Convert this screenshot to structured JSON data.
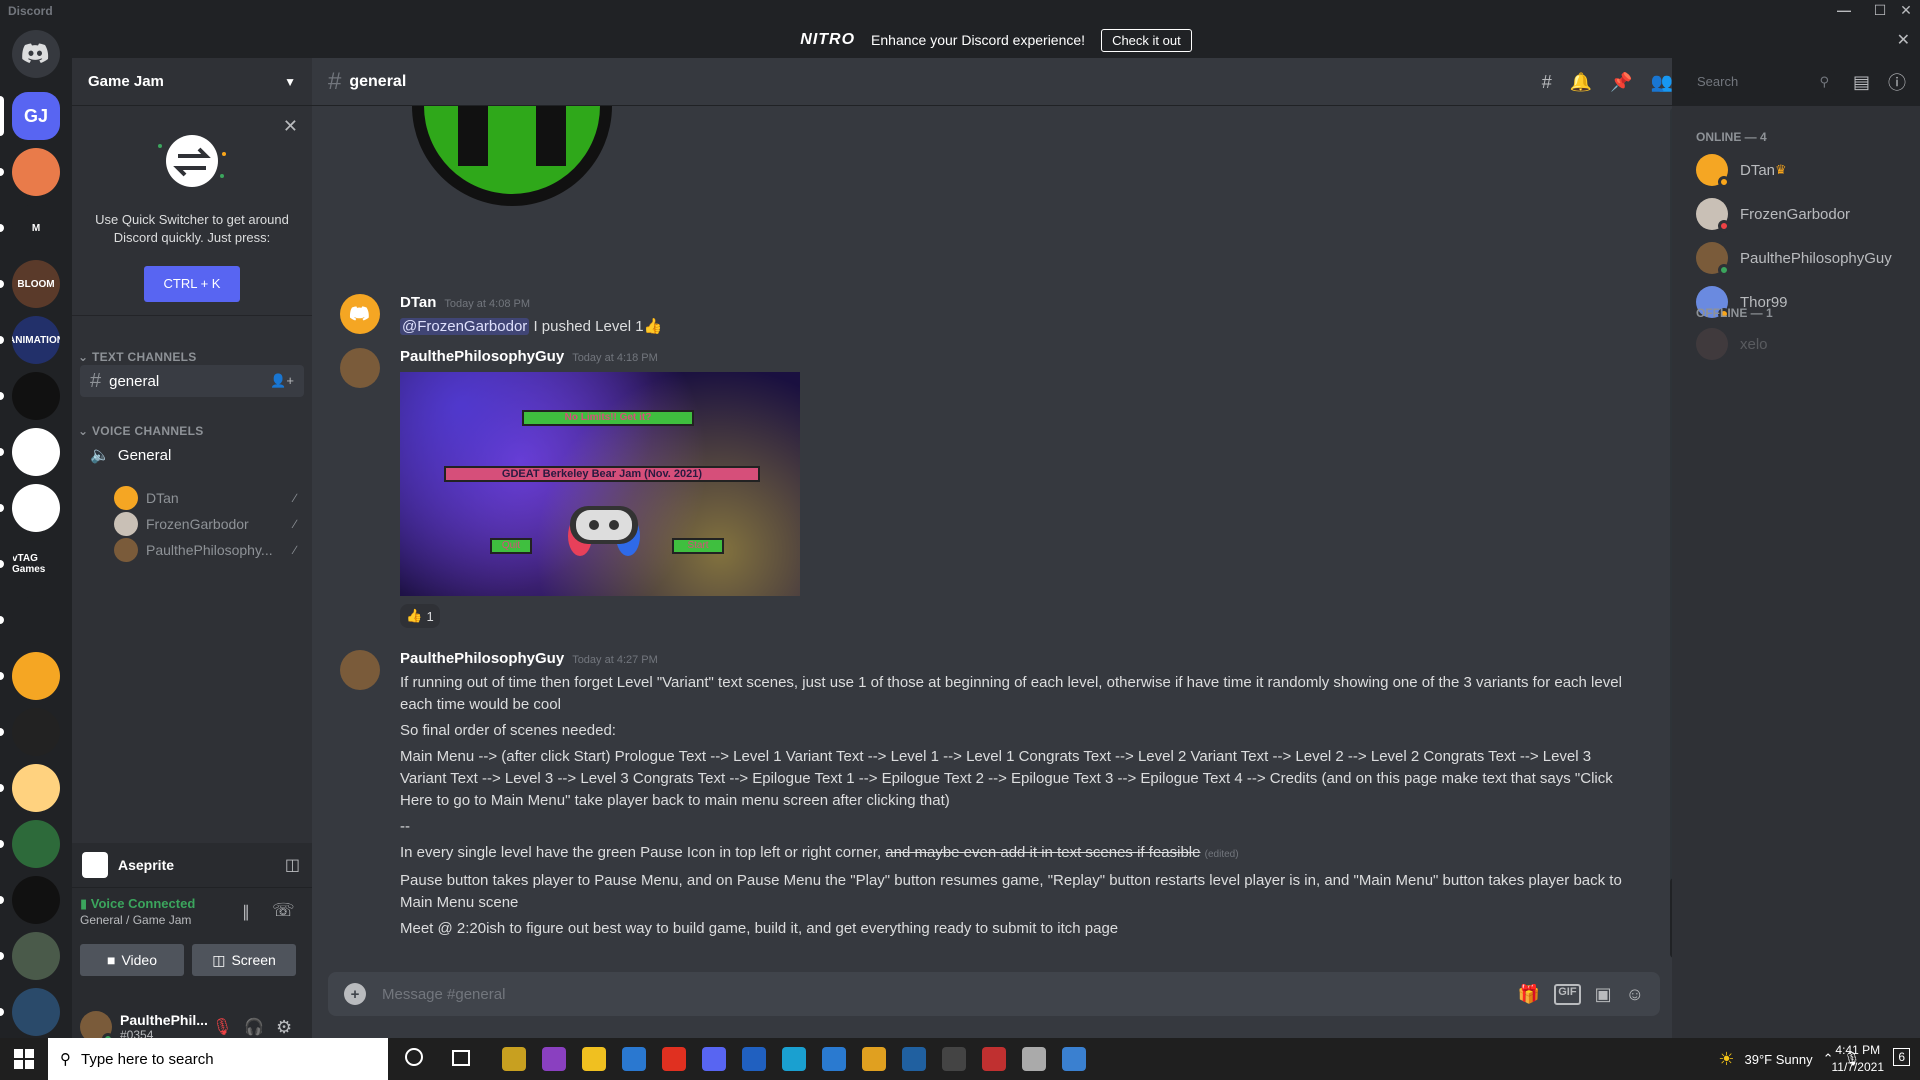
{
  "window": {
    "title": "Discord"
  },
  "banner": {
    "logo": "NITRO",
    "text": "Enhance your Discord experience!",
    "cta": "Check it out"
  },
  "rail": {
    "home_icon": "discord-logo-icon",
    "servers": [
      {
        "label": "GJ",
        "color": "#5865f2"
      },
      {
        "label": "",
        "color": "#e97b4a"
      },
      {
        "label": "M",
        "color": "#202225"
      },
      {
        "label": "BLOOM",
        "color": "#5a3a2a"
      },
      {
        "label": "ANIMATION",
        "color": "#22306a"
      },
      {
        "label": "",
        "color": "#111"
      },
      {
        "label": "",
        "color": "#fff"
      },
      {
        "label": "",
        "color": "#fff"
      },
      {
        "label": "vTAG Games",
        "color": "#202225"
      },
      {
        "label": "",
        "color": "#202225"
      },
      {
        "label": "",
        "color": "#f5a623"
      },
      {
        "label": "",
        "color": "#222"
      },
      {
        "label": "",
        "color": "#ffd27f"
      },
      {
        "label": "",
        "color": "#2d6a3a"
      },
      {
        "label": "",
        "color": "#111"
      },
      {
        "label": "",
        "color": "#4a5a4a"
      },
      {
        "label": "",
        "color": "#2a4a6a"
      }
    ]
  },
  "sidebar": {
    "guild_name": "Game Jam",
    "quick_switcher": {
      "text": "Use Quick Switcher to get around Discord quickly. Just press:",
      "button": "CTRL + K"
    },
    "text_category": "TEXT CHANNELS",
    "text_channels": [
      {
        "name": "general"
      }
    ],
    "voice_category": "VOICE CHANNELS",
    "voice_channels": [
      {
        "name": "General",
        "users": [
          {
            "name": "DTan",
            "color": "#f5a623"
          },
          {
            "name": "FrozenGarbodor",
            "color": "#c9c0b6"
          },
          {
            "name": "PaulthePhilosophy...",
            "color": "#7a5b3a"
          }
        ]
      }
    ]
  },
  "activity": {
    "name": "Aseprite"
  },
  "voice": {
    "status": "Voice Connected",
    "location": "General / Game Jam",
    "video": "Video",
    "screen": "Screen"
  },
  "user": {
    "name": "PaulthePhil...",
    "tag": "#0354"
  },
  "channel": {
    "name": "general",
    "search_placeholder": "Search"
  },
  "messages": [
    {
      "author": "DTan",
      "time": "Today at 4:08 PM",
      "mention": "@FrozenGarbodor",
      "text": " I pushed Level 1👍"
    },
    {
      "author": "PaulthePhilosophyGuy",
      "time": "Today at 4:18 PM",
      "reaction": {
        "emoji": "👍",
        "count": "1"
      },
      "image": {
        "title": "GDEAT Berkeley Bear Jam (Nov. 2021)",
        "top": "No Limits!! Get it?",
        "left": "Quit",
        "right": "Start"
      }
    },
    {
      "author": "PaulthePhilosophyGuy",
      "time": "Today at 4:27 PM",
      "lines": [
        "If running out of time then forget Level \"Variant\" text scenes, just use 1 of those at beginning of each level, otherwise if have time it randomly showing one of the 3 variants for each level each time would be cool",
        "So final order of scenes needed:",
        "Main Menu --> (after click Start) Prologue Text --> Level 1 Variant Text --> Level 1 --> Level 1 Congrats Text --> Level 2 Variant Text --> Level 2 --> Level 2 Congrats Text --> Level 3 Variant Text --> Level 3 --> Level 3 Congrats Text --> Epilogue Text 1 --> Epilogue Text 2 --> Epilogue Text 3 --> Epilogue Text 4 --> Credits (and on this page make text that says \"Click Here to go to Main Menu\" take player back to main menu screen after clicking that)",
        "--"
      ],
      "strike_pre": "In every single level have the green Pause Icon in top left or right corner, ",
      "strike_text": "and maybe even add it in text scenes if feasible",
      "edited": "(edited)",
      "more": [
        "Pause button takes player to Pause Menu, and on Pause Menu the \"Play\" button resumes game, \"Replay\" button restarts level player is in, and \"Main Menu\" button takes player back to Main Menu scene",
        "Meet @ 2:20ish to figure out best way to build game, build it, and get everything ready to submit to itch page"
      ]
    }
  ],
  "composer": {
    "placeholder": "Message #general",
    "gif": "GIF"
  },
  "members": {
    "online_header": "ONLINE — 4",
    "offline_header": "OFFLINE — 1",
    "online": [
      {
        "name": "DTan",
        "color": "#f5a623",
        "status": "#faa61a"
      },
      {
        "name": "FrozenGarbodor",
        "color": "#c9c0b6",
        "status": "#ed4245"
      },
      {
        "name": "PaulthePhilosophyGuy",
        "color": "#7a5b3a",
        "status": "#3ba55d"
      },
      {
        "name": "Thor99",
        "color": "#6a8ae0",
        "status": "#faa61a"
      }
    ],
    "offline": [
      {
        "name": "xelo",
        "color": "#6a5050"
      }
    ]
  },
  "taskbar": {
    "search": "Type here to search",
    "weather": "39°F  Sunny",
    "time": "4:41 PM",
    "date": "11/7/2021",
    "notif": "6"
  }
}
